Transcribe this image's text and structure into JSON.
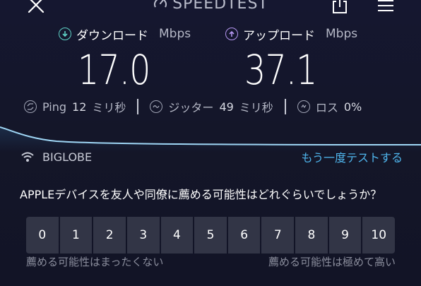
{
  "header": {
    "brand": "SPEEDTEST",
    "icons": {
      "close": "close-icon",
      "share": "share-icon",
      "menu": "menu-icon",
      "logo": "speedometer-icon"
    }
  },
  "download": {
    "label": "ダウンロード",
    "unit": "Mbps",
    "value": "17.0",
    "icon": "download-arrow-icon",
    "color": "#5fd3c7"
  },
  "upload": {
    "label": "アップロード",
    "unit": "Mbps",
    "value": "37.1",
    "icon": "upload-arrow-icon",
    "color": "#b596f0"
  },
  "stats": {
    "ping_label": "Ping",
    "ping_value": "12",
    "ping_unit": "ミリ秒",
    "jitter_label": "ジッター",
    "jitter_value": "49",
    "jitter_unit": "ミリ秒",
    "loss_label": "ロス",
    "loss_value": "0%"
  },
  "isp": {
    "name": "BIGLOBE",
    "icon": "wifi-icon"
  },
  "actions": {
    "test_again": "もう一度テストする"
  },
  "survey": {
    "question": "APPLEデバイスを友人や同僚に薦める可能性はどれぐらいでしょうか？",
    "scores": [
      "0",
      "1",
      "2",
      "3",
      "4",
      "5",
      "6",
      "7",
      "8",
      "9",
      "10"
    ],
    "low_label": "薦める可能性はまったくない",
    "high_label": "薦める可能性は極めて高い"
  },
  "colors": {
    "background": "#131628",
    "accent_link": "#4fb5ec",
    "button_bg": "#323546"
  }
}
